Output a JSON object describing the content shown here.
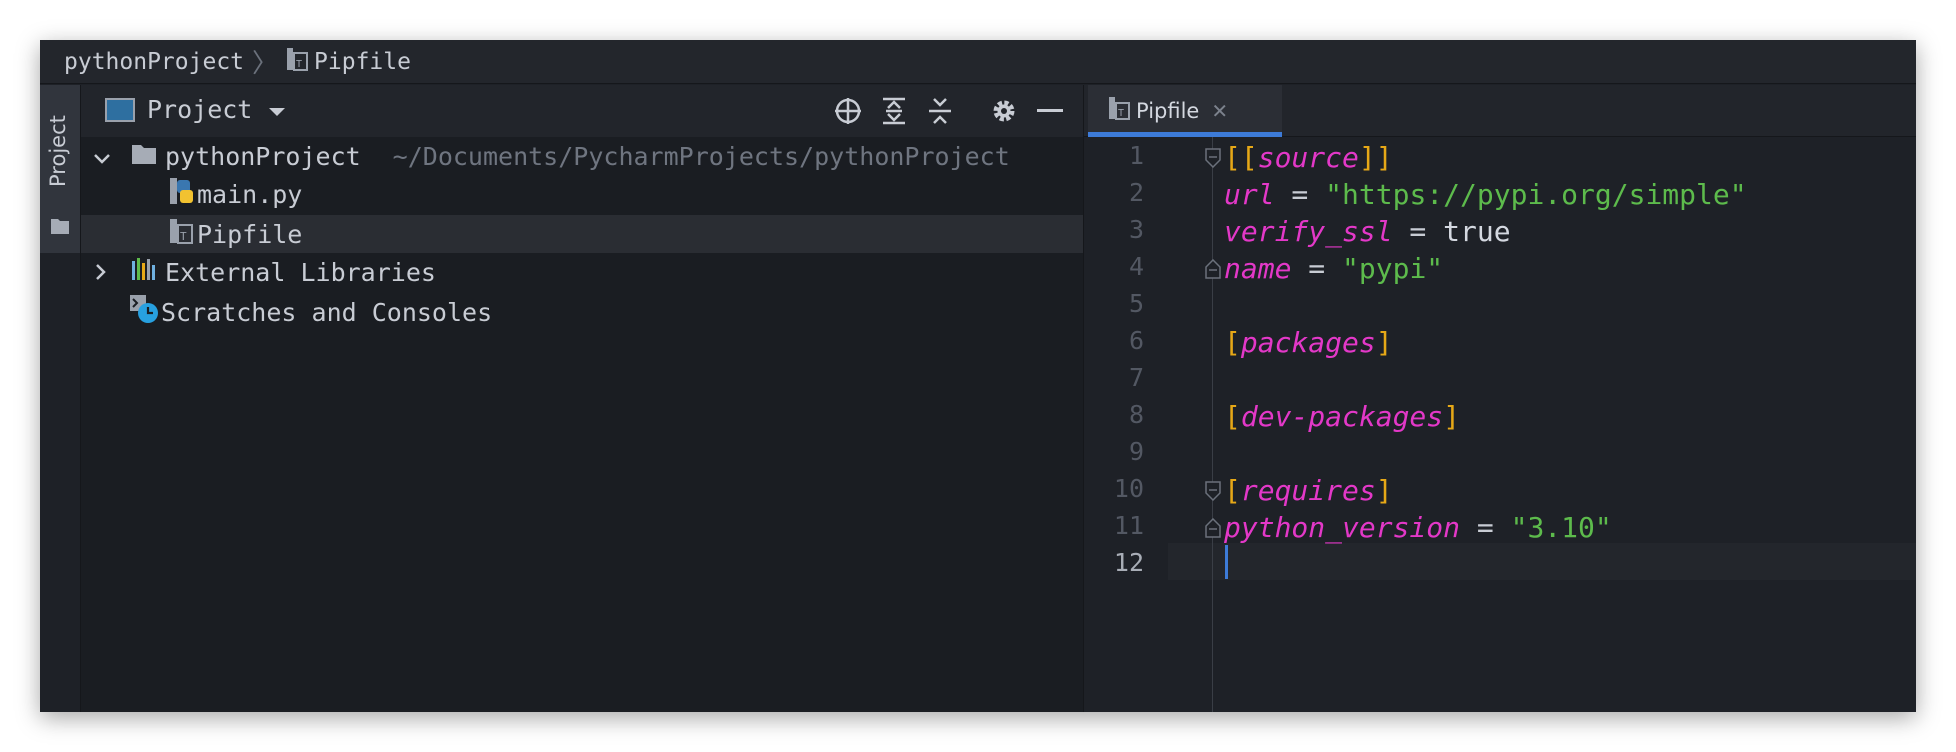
{
  "breadcrumb": {
    "project": "pythonProject",
    "separator": "〉",
    "file": "Pipfile"
  },
  "tool_stripe": {
    "label": "Project",
    "icon": "folder-icon"
  },
  "project_panel": {
    "title": "Project",
    "tools": [
      "locate-icon",
      "expand-all-icon",
      "collapse-all-icon",
      "gear-icon",
      "minimize-icon"
    ],
    "tree": [
      {
        "label": "pythonProject",
        "path": "~/Documents/PycharmProjects/pythonProject",
        "icon": "folder-icon",
        "expanded": true
      },
      {
        "label": "main.py",
        "icon": "python-file-icon"
      },
      {
        "label": "Pipfile",
        "icon": "pipfile-icon",
        "selected": true
      },
      {
        "label": "External Libraries",
        "icon": "libraries-icon",
        "expanded": false
      },
      {
        "label": "Scratches and Consoles",
        "icon": "scratches-icon"
      }
    ]
  },
  "editor": {
    "tab": {
      "label": "Pipfile",
      "close": "✕"
    },
    "line_numbers": [
      "1",
      "2",
      "3",
      "4",
      "5",
      "6",
      "7",
      "8",
      "9",
      "10",
      "11",
      "12"
    ],
    "current_line": 12,
    "code": {
      "l1": {
        "open": "[[",
        "name": "source",
        "close": "]]"
      },
      "l2": {
        "key": "url",
        "eq": " = ",
        "value": "\"https://pypi.org/simple\""
      },
      "l3": {
        "key": "verify_ssl",
        "eq": " = ",
        "value": "true"
      },
      "l4": {
        "key": "name",
        "eq": " = ",
        "value": "\"pypi\""
      },
      "l6": {
        "open": "[",
        "name": "packages",
        "close": "]"
      },
      "l8": {
        "open": "[",
        "name": "dev-packages",
        "close": "]"
      },
      "l10": {
        "open": "[",
        "name": "requires",
        "close": "]"
      },
      "l11": {
        "key": "python_version",
        "eq": " = ",
        "value": "\"3.10\""
      }
    }
  },
  "colors": {
    "accent": "#3d7bd8",
    "section": "#e338c8",
    "bracket": "#e6a817",
    "string": "#5dbb4c"
  }
}
